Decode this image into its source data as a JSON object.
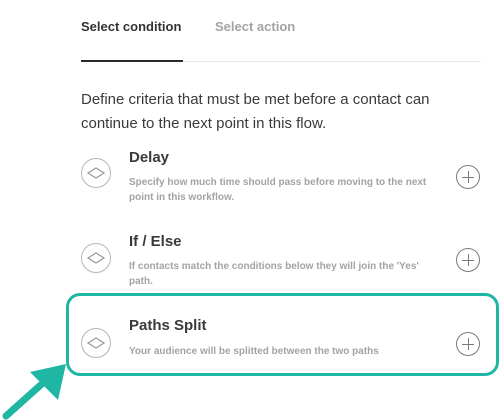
{
  "tabs": [
    {
      "label": "Select condition",
      "active": true
    },
    {
      "label": "Select action",
      "active": false
    }
  ],
  "description": "Define criteria that must be met before a contact can continue to the next point in this flow.",
  "options": [
    {
      "title": "Delay",
      "description": "Specify how much time should pass before moving to the next point in this workflow.",
      "icon": "condition-diamond-icon",
      "action_icon": "plus-icon"
    },
    {
      "title": "If / Else",
      "description": "If contacts match the conditions below they will join the 'Yes' path.",
      "icon": "condition-diamond-icon",
      "action_icon": "plus-icon"
    },
    {
      "title": "Paths Split",
      "description": "Your audience will be splitted between the two paths",
      "icon": "condition-diamond-icon",
      "action_icon": "plus-icon",
      "highlighted": true
    }
  ],
  "colors": {
    "highlight": "#1fb6a3",
    "text": "#3a3a3a",
    "muted": "#a3a3a3"
  }
}
